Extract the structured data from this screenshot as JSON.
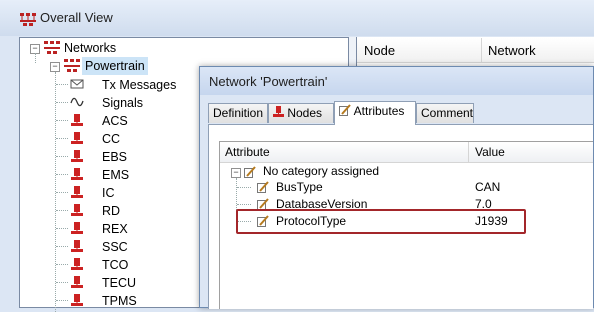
{
  "window": {
    "title": "Overall View"
  },
  "tree": {
    "root_label": "Networks",
    "network_label": "Powertrain",
    "children": [
      {
        "label": "Tx Messages",
        "icon": "envelope-icon"
      },
      {
        "label": "Signals",
        "icon": "signal-wave-icon"
      },
      {
        "label": "ACS",
        "icon": "ecu-node-icon"
      },
      {
        "label": "CC",
        "icon": "ecu-node-icon"
      },
      {
        "label": "EBS",
        "icon": "ecu-node-icon"
      },
      {
        "label": "EMS",
        "icon": "ecu-node-icon"
      },
      {
        "label": "IC",
        "icon": "ecu-node-icon"
      },
      {
        "label": "RD",
        "icon": "ecu-node-icon"
      },
      {
        "label": "REX",
        "icon": "ecu-node-icon"
      },
      {
        "label": "SSC",
        "icon": "ecu-node-icon"
      },
      {
        "label": "TCO",
        "icon": "ecu-node-icon"
      },
      {
        "label": "TECU",
        "icon": "ecu-node-icon"
      },
      {
        "label": "TPMS",
        "icon": "ecu-node-icon"
      }
    ]
  },
  "grid": {
    "columns": [
      "Node",
      "Network"
    ]
  },
  "dialog": {
    "title": "Network 'Powertrain'",
    "tabs": [
      "Definition",
      "Nodes",
      "Attributes",
      "Comment"
    ],
    "active_tab": "Attributes",
    "attr_columns": [
      "Attribute",
      "Value"
    ],
    "category_label": "No category assigned",
    "attributes": [
      {
        "name": "BusType",
        "value": "CAN"
      },
      {
        "name": "DatabaseVersion",
        "value": "7.0"
      },
      {
        "name": "ProtocolType",
        "value": "J1939"
      }
    ],
    "highlight_color": "#a3262a"
  }
}
